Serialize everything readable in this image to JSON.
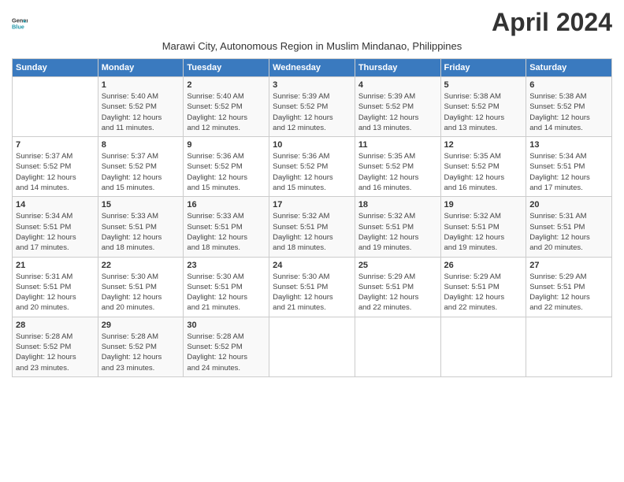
{
  "header": {
    "logo_line1": "General",
    "logo_line2": "Blue",
    "month_title": "April 2024",
    "subtitle": "Marawi City, Autonomous Region in Muslim Mindanao, Philippines"
  },
  "days_of_week": [
    "Sunday",
    "Monday",
    "Tuesday",
    "Wednesday",
    "Thursday",
    "Friday",
    "Saturday"
  ],
  "weeks": [
    [
      {
        "num": "",
        "info": ""
      },
      {
        "num": "1",
        "info": "Sunrise: 5:40 AM\nSunset: 5:52 PM\nDaylight: 12 hours\nand 11 minutes."
      },
      {
        "num": "2",
        "info": "Sunrise: 5:40 AM\nSunset: 5:52 PM\nDaylight: 12 hours\nand 12 minutes."
      },
      {
        "num": "3",
        "info": "Sunrise: 5:39 AM\nSunset: 5:52 PM\nDaylight: 12 hours\nand 12 minutes."
      },
      {
        "num": "4",
        "info": "Sunrise: 5:39 AM\nSunset: 5:52 PM\nDaylight: 12 hours\nand 13 minutes."
      },
      {
        "num": "5",
        "info": "Sunrise: 5:38 AM\nSunset: 5:52 PM\nDaylight: 12 hours\nand 13 minutes."
      },
      {
        "num": "6",
        "info": "Sunrise: 5:38 AM\nSunset: 5:52 PM\nDaylight: 12 hours\nand 14 minutes."
      }
    ],
    [
      {
        "num": "7",
        "info": "Sunrise: 5:37 AM\nSunset: 5:52 PM\nDaylight: 12 hours\nand 14 minutes."
      },
      {
        "num": "8",
        "info": "Sunrise: 5:37 AM\nSunset: 5:52 PM\nDaylight: 12 hours\nand 15 minutes."
      },
      {
        "num": "9",
        "info": "Sunrise: 5:36 AM\nSunset: 5:52 PM\nDaylight: 12 hours\nand 15 minutes."
      },
      {
        "num": "10",
        "info": "Sunrise: 5:36 AM\nSunset: 5:52 PM\nDaylight: 12 hours\nand 15 minutes."
      },
      {
        "num": "11",
        "info": "Sunrise: 5:35 AM\nSunset: 5:52 PM\nDaylight: 12 hours\nand 16 minutes."
      },
      {
        "num": "12",
        "info": "Sunrise: 5:35 AM\nSunset: 5:52 PM\nDaylight: 12 hours\nand 16 minutes."
      },
      {
        "num": "13",
        "info": "Sunrise: 5:34 AM\nSunset: 5:51 PM\nDaylight: 12 hours\nand 17 minutes."
      }
    ],
    [
      {
        "num": "14",
        "info": "Sunrise: 5:34 AM\nSunset: 5:51 PM\nDaylight: 12 hours\nand 17 minutes."
      },
      {
        "num": "15",
        "info": "Sunrise: 5:33 AM\nSunset: 5:51 PM\nDaylight: 12 hours\nand 18 minutes."
      },
      {
        "num": "16",
        "info": "Sunrise: 5:33 AM\nSunset: 5:51 PM\nDaylight: 12 hours\nand 18 minutes."
      },
      {
        "num": "17",
        "info": "Sunrise: 5:32 AM\nSunset: 5:51 PM\nDaylight: 12 hours\nand 18 minutes."
      },
      {
        "num": "18",
        "info": "Sunrise: 5:32 AM\nSunset: 5:51 PM\nDaylight: 12 hours\nand 19 minutes."
      },
      {
        "num": "19",
        "info": "Sunrise: 5:32 AM\nSunset: 5:51 PM\nDaylight: 12 hours\nand 19 minutes."
      },
      {
        "num": "20",
        "info": "Sunrise: 5:31 AM\nSunset: 5:51 PM\nDaylight: 12 hours\nand 20 minutes."
      }
    ],
    [
      {
        "num": "21",
        "info": "Sunrise: 5:31 AM\nSunset: 5:51 PM\nDaylight: 12 hours\nand 20 minutes."
      },
      {
        "num": "22",
        "info": "Sunrise: 5:30 AM\nSunset: 5:51 PM\nDaylight: 12 hours\nand 20 minutes."
      },
      {
        "num": "23",
        "info": "Sunrise: 5:30 AM\nSunset: 5:51 PM\nDaylight: 12 hours\nand 21 minutes."
      },
      {
        "num": "24",
        "info": "Sunrise: 5:30 AM\nSunset: 5:51 PM\nDaylight: 12 hours\nand 21 minutes."
      },
      {
        "num": "25",
        "info": "Sunrise: 5:29 AM\nSunset: 5:51 PM\nDaylight: 12 hours\nand 22 minutes."
      },
      {
        "num": "26",
        "info": "Sunrise: 5:29 AM\nSunset: 5:51 PM\nDaylight: 12 hours\nand 22 minutes."
      },
      {
        "num": "27",
        "info": "Sunrise: 5:29 AM\nSunset: 5:51 PM\nDaylight: 12 hours\nand 22 minutes."
      }
    ],
    [
      {
        "num": "28",
        "info": "Sunrise: 5:28 AM\nSunset: 5:52 PM\nDaylight: 12 hours\nand 23 minutes."
      },
      {
        "num": "29",
        "info": "Sunrise: 5:28 AM\nSunset: 5:52 PM\nDaylight: 12 hours\nand 23 minutes."
      },
      {
        "num": "30",
        "info": "Sunrise: 5:28 AM\nSunset: 5:52 PM\nDaylight: 12 hours\nand 24 minutes."
      },
      {
        "num": "",
        "info": ""
      },
      {
        "num": "",
        "info": ""
      },
      {
        "num": "",
        "info": ""
      },
      {
        "num": "",
        "info": ""
      }
    ]
  ]
}
